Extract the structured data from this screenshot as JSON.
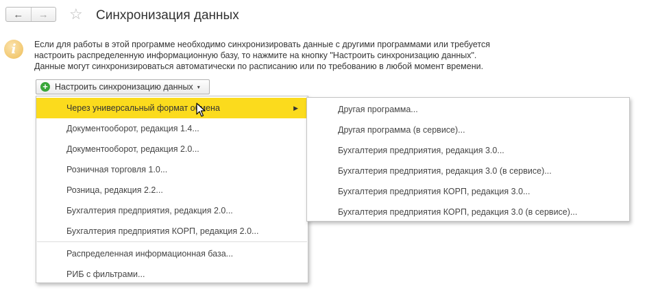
{
  "header": {
    "title": "Синхронизация данных",
    "back_icon": "←",
    "forward_icon": "→",
    "favorite_icon": "☆"
  },
  "info": {
    "icon_glyph": "i",
    "lines": [
      "Если для работы в этой программе необходимо синхронизировать данные с другими программами или требуется",
      "настроить распределенную информационную базу, то нажмите на кнопку \"Настроить синхронизацию данных\".",
      "Данные могут синхронизироваться автоматически по расписанию или по требованию в любой момент времени."
    ]
  },
  "setup_button": {
    "icon_glyph": "+",
    "label": "Настроить синхронизацию данных",
    "caret": "▾"
  },
  "menu": {
    "items": [
      {
        "label": "Через универсальный формат обмена",
        "arrow": "▶"
      },
      {
        "label": "Документооборот, редакция 1.4..."
      },
      {
        "label": "Документооборот, редакция 2.0..."
      },
      {
        "label": "Розничная торговля 1.0..."
      },
      {
        "label": "Розница, редакция 2.2..."
      },
      {
        "label": "Бухгалтерия предприятия, редакция 2.0..."
      },
      {
        "label": "Бухгалтерия предприятия КОРП, редакция 2.0..."
      },
      {
        "label": "Распределенная информационная база..."
      },
      {
        "label": "РИБ с фильтрами..."
      }
    ]
  },
  "submenu": {
    "items": [
      {
        "label": "Другая программа..."
      },
      {
        "label": "Другая программа (в сервисе)..."
      },
      {
        "label": "Бухгалтерия предприятия, редакция 3.0..."
      },
      {
        "label": "Бухгалтерия предприятия, редакция 3.0 (в сервисе)..."
      },
      {
        "label": "Бухгалтерия предприятия КОРП, редакция 3.0..."
      },
      {
        "label": "Бухгалтерия предприятия КОРП, редакция 3.0 (в сервисе)..."
      }
    ]
  },
  "colors": {
    "highlight": "#fbdb1d",
    "info_icon": "#eebd58",
    "plus_icon": "#3aa63a"
  }
}
